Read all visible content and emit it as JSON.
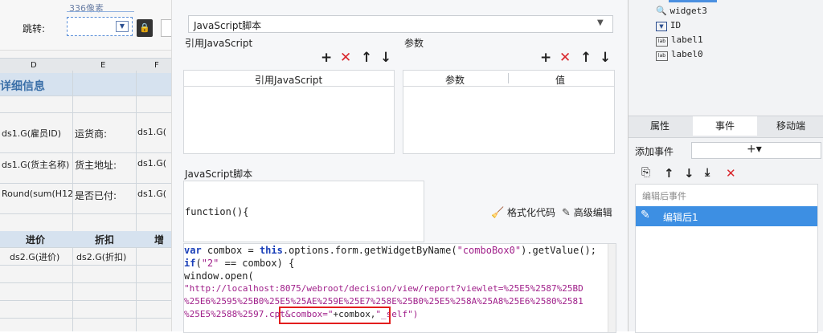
{
  "left": {
    "size_hint": "336像素",
    "jump_label": "跳转:",
    "col_headers": [
      "D",
      "E",
      "F"
    ],
    "section_title": "详细信息",
    "rows": [
      {
        "d": "ds1.G(雇员ID)",
        "e": "运货商:",
        "f": "ds1.G("
      },
      {
        "d": "ds1.G(货主名称)",
        "e": "货主地址:",
        "f": "ds1.G("
      },
      {
        "d": "Round(sum(H12",
        "e": "是否已付:",
        "f": "ds1.G("
      }
    ],
    "lower_headers": [
      "进价",
      "折扣",
      "增"
    ],
    "lower_row": [
      "ds2.G(进价)",
      "ds2.G(折扣)"
    ]
  },
  "center": {
    "type_select": "JavaScript脚本",
    "ref_js_label": "引用JavaScript",
    "params_label": "参数",
    "ref_js_col": "引用JavaScript",
    "param_col": "参数",
    "value_col": "值",
    "script_label": "JavaScript脚本",
    "function_sig": "function(){",
    "format_code": "格式化代码",
    "advanced_edit": "高级编辑",
    "code": {
      "l1a": "var",
      "l1b": " combox = ",
      "l1c": "this",
      "l1d": ".options.form.getWidgetByName(",
      "l1e": "\"comboBox0\"",
      "l1f": ").getValue();",
      "l2a": "if",
      "l2b": "(",
      "l2c": "\"2\"",
      "l2d": " == combox) {",
      "l3": "window.open(",
      "l4": "\"http://localhost:8075/webroot/decision/view/report?viewlet=%25E5%2587%25BD",
      "l5": "%25E6%2595%25B0%25E5%25AE%259E%25E7%258E%25B0%25E5%258A%25A8%25E6%2580%2581",
      "l6a": "%25E5%2588%2597.",
      "l6b": "cpt&combox=\"",
      "l6c": "+combox,",
      "l6d": "\"_self\")"
    }
  },
  "right": {
    "tree": [
      "widget3",
      "ID",
      "label1",
      "label0"
    ],
    "tabs": [
      "属性",
      "事件",
      "移动端"
    ],
    "add_event": "添加事件",
    "add_symbol": "+▾",
    "after_edit_header": "编辑后事件",
    "event_item": "编辑后1"
  }
}
